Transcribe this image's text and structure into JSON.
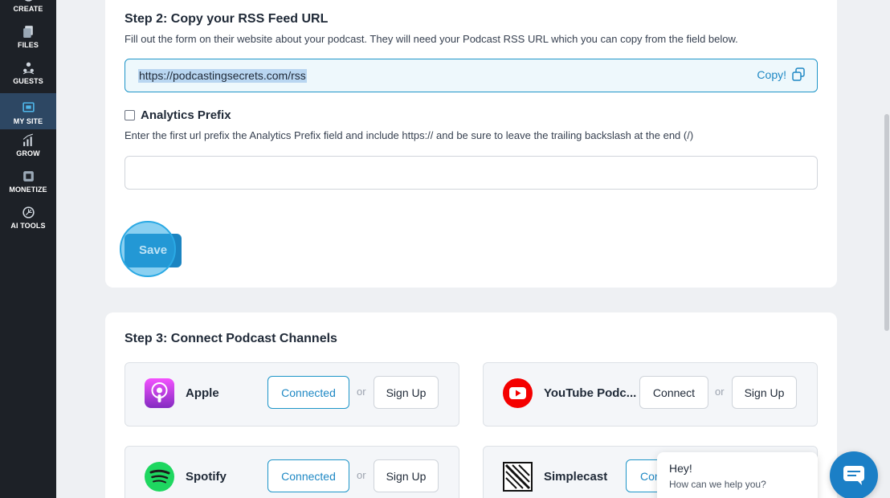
{
  "sidebar": {
    "items": [
      {
        "label": "CREATE",
        "icon": "create-icon"
      },
      {
        "label": "FILES",
        "icon": "files-icon"
      },
      {
        "label": "GUESTS",
        "icon": "guests-icon"
      },
      {
        "label": "MY SITE",
        "icon": "my-site-icon",
        "active": true
      },
      {
        "label": "GROW",
        "icon": "grow-icon"
      },
      {
        "label": "MONETIZE",
        "icon": "monetize-icon"
      },
      {
        "label": "AI TOOLS",
        "icon": "ai-tools-icon"
      }
    ]
  },
  "step2": {
    "title": "Step 2: Copy your RSS Feed URL",
    "description": "Fill out the form on their website about your podcast. They will need your Podcast RSS URL which you can copy from the field below.",
    "rss_url": "https://podcastingsecrets.com/rss",
    "copy_label": "Copy!"
  },
  "analytics": {
    "label": "Analytics Prefix",
    "checked": false,
    "description": "Enter the first url prefix the Analytics Prefix field and include https:// and be sure to leave the trailing backslash at the end (/)",
    "value": ""
  },
  "save_label": "Save",
  "step3": {
    "title": "Step 3: Connect Podcast Channels",
    "or_text": "or",
    "channels": [
      {
        "name": "Apple",
        "icon": "apple-podcasts-icon",
        "action": "Connected",
        "signup": "Sign Up"
      },
      {
        "name": "YouTube Podc...",
        "icon": "youtube-icon",
        "action": "Connect",
        "signup": "Sign Up"
      },
      {
        "name": "Spotify",
        "icon": "spotify-icon",
        "action": "Connected",
        "signup": "Sign Up"
      },
      {
        "name": "Simplecast",
        "icon": "simplecast-icon",
        "action": "Cor",
        "signup": ""
      }
    ]
  },
  "chat": {
    "title": "Hey!",
    "subtitle": "How can we help you?",
    "icon": "chat-icon"
  },
  "colors": {
    "sidebar_bg": "#1d2127",
    "sidebar_active": "#2d4763",
    "accent": "#1e88c4",
    "save_button": "#1b84c1",
    "page_bg": "#eef0f3"
  }
}
